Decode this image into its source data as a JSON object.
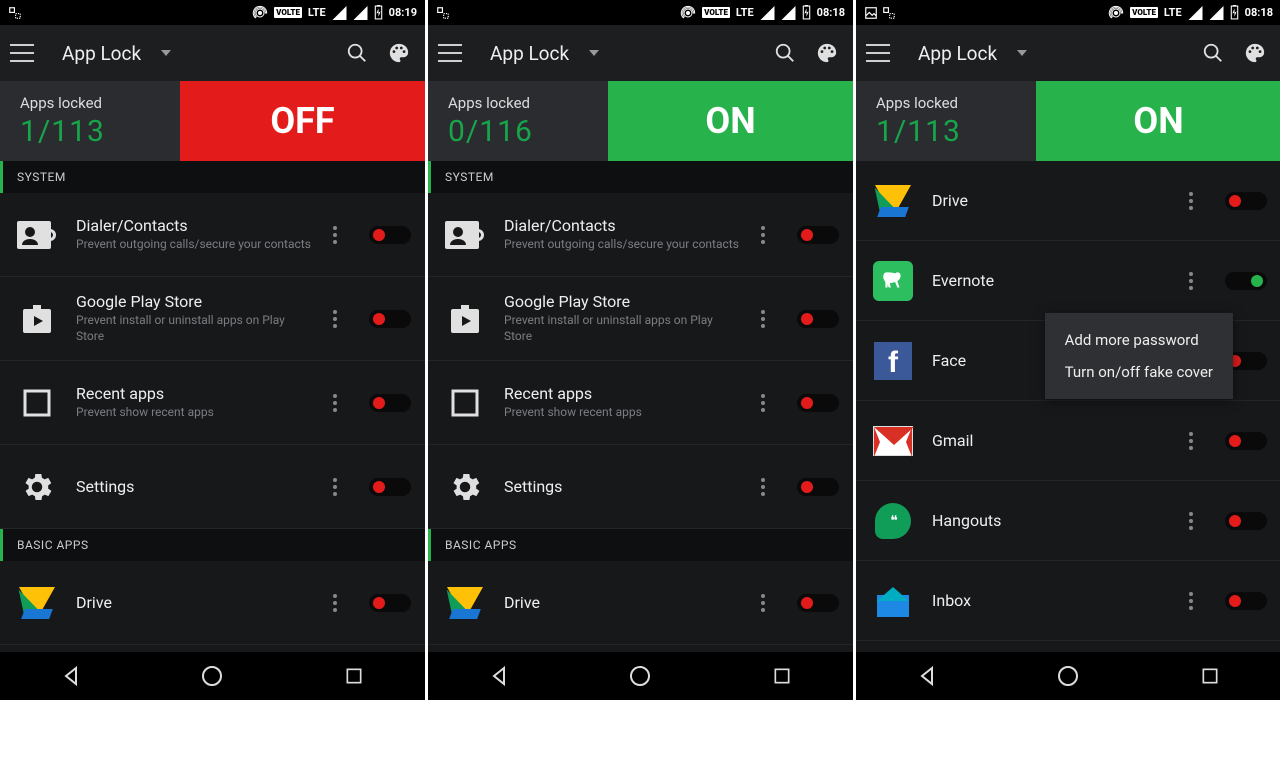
{
  "screens": [
    {
      "status": {
        "time": "08:19",
        "lte": "LTE",
        "volte": "VOLTE"
      },
      "appbar": {
        "title": "App Lock"
      },
      "hero": {
        "label": "Apps locked",
        "count": "1/113",
        "state": "OFF",
        "state_class": "off"
      },
      "sections": [
        {
          "header": "SYSTEM",
          "rows": [
            {
              "name": "Dialer/Contacts",
              "sub": "Prevent outgoing calls/secure your contacts",
              "icon": "contacts",
              "toggle": "off"
            },
            {
              "name": "Google Play Store",
              "sub": "Prevent install or uninstall apps on Play Store",
              "icon": "play",
              "toggle": "off"
            },
            {
              "name": "Recent apps",
              "sub": "Prevent show recent apps",
              "icon": "recent",
              "toggle": "off"
            },
            {
              "name": "Settings",
              "sub": "",
              "icon": "gear",
              "toggle": "off"
            }
          ]
        },
        {
          "header": "BASIC APPS",
          "rows": [
            {
              "name": "Drive",
              "sub": "",
              "icon": "drive",
              "toggle": "off"
            }
          ]
        }
      ]
    },
    {
      "status": {
        "time": "08:18",
        "lte": "LTE",
        "volte": "VOLTE"
      },
      "appbar": {
        "title": "App Lock"
      },
      "hero": {
        "label": "Apps locked",
        "count": "0/116",
        "state": "ON",
        "state_class": "on"
      },
      "sections": [
        {
          "header": "SYSTEM",
          "rows": [
            {
              "name": "Dialer/Contacts",
              "sub": "Prevent outgoing calls/secure your contacts",
              "icon": "contacts",
              "toggle": "off"
            },
            {
              "name": "Google Play Store",
              "sub": "Prevent install or uninstall apps on Play Store",
              "icon": "play",
              "toggle": "off"
            },
            {
              "name": "Recent apps",
              "sub": "Prevent show recent apps",
              "icon": "recent",
              "toggle": "off"
            },
            {
              "name": "Settings",
              "sub": "",
              "icon": "gear",
              "toggle": "off"
            }
          ]
        },
        {
          "header": "BASIC APPS",
          "rows": [
            {
              "name": "Drive",
              "sub": "",
              "icon": "drive",
              "toggle": "off"
            }
          ]
        }
      ]
    },
    {
      "status": {
        "time": "08:18",
        "lte": "LTE",
        "volte": "VOLTE"
      },
      "appbar": {
        "title": "App Lock"
      },
      "hero": {
        "label": "Apps locked",
        "count": "1/113",
        "state": "ON",
        "state_class": "on"
      },
      "popup": {
        "line1": "Add more password",
        "line2": "Turn on/off fake cover"
      },
      "rows": [
        {
          "name": "Drive",
          "icon": "drive",
          "toggle": "off"
        },
        {
          "name": "Evernote",
          "icon": "evernote",
          "toggle": "on"
        },
        {
          "name": "Face",
          "icon": "fb",
          "toggle": "off",
          "has_popup": true
        },
        {
          "name": "Gmail",
          "icon": "gmail",
          "toggle": "off"
        },
        {
          "name": "Hangouts",
          "icon": "hangouts",
          "toggle": "off"
        },
        {
          "name": "Inbox",
          "icon": "inbox",
          "toggle": "off"
        }
      ]
    }
  ]
}
